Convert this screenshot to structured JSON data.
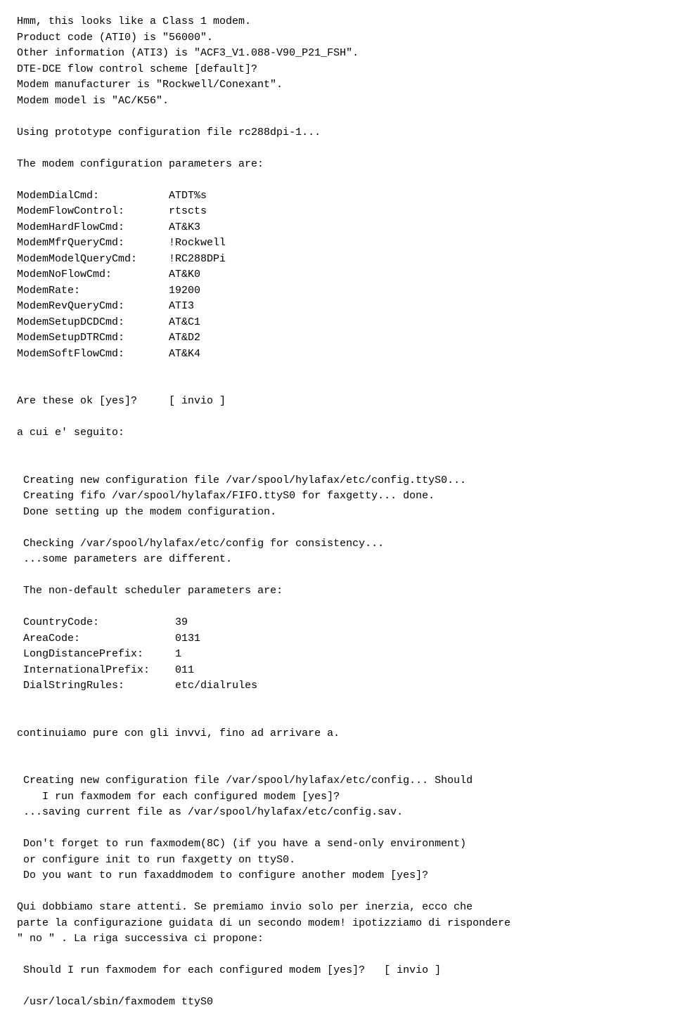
{
  "content": {
    "lines": [
      "Hmm, this looks like a Class 1 modem.",
      "Product code (ATI0) is \"56000\".",
      "Other information (ATI3) is \"ACF3_V1.088-V90_P21_FSH\".",
      "DTE-DCE flow control scheme [default]?",
      "Modem manufacturer is \"Rockwell/Conexant\".",
      "Modem model is \"AC/K56\".",
      "",
      "Using prototype configuration file rc288dpi-1...",
      "",
      "The modem configuration parameters are:",
      "",
      "ModemDialCmd:           ATDT%s",
      "ModemFlowControl:       rtscts",
      "ModemHardFlowCmd:       AT&K3",
      "ModemMfrQueryCmd:       !Rockwell",
      "ModemModelQueryCmd:     !RC288DPi",
      "ModemNoFlowCmd:         AT&K0",
      "ModemRate:              19200",
      "ModemRevQueryCmd:       ATI3",
      "ModemSetupDCDCmd:       AT&C1",
      "ModemSetupDTRCmd:       AT&D2",
      "ModemSoftFlowCmd:       AT&K4",
      "",
      "",
      "Are these ok [yes]?     [ invio ]",
      "",
      "a cui e' seguito:",
      "",
      "",
      " Creating new configuration file /var/spool/hylafax/etc/config.ttyS0...",
      " Creating fifo /var/spool/hylafax/FIFO.ttyS0 for faxgetty... done.",
      " Done setting up the modem configuration.",
      "",
      " Checking /var/spool/hylafax/etc/config for consistency...",
      " ...some parameters are different.",
      "",
      " The non-default scheduler parameters are:",
      "",
      " CountryCode:            39",
      " AreaCode:               0131",
      " LongDistancePrefix:     1",
      " InternationalPrefix:    011",
      " DialStringRules:        etc/dialrules",
      "",
      "",
      "continuiamo pure con gli invvi, fino ad arrivare a.",
      "",
      "",
      " Creating new configuration file /var/spool/hylafax/etc/config... Should",
      "    I run faxmodem for each configured modem [yes]?",
      " ...saving current file as /var/spool/hylafax/etc/config.sav.",
      "",
      " Don't forget to run faxmodem(8C) (if you have a send-only environment)",
      " or configure init to run faxgetty on ttyS0.",
      " Do you want to run faxaddmodem to configure another modem [yes]?",
      "",
      "Qui dobbiamo stare attenti. Se premiamo invio solo per inerzia, ecco che",
      "parte la configurazione guidata di un secondo modem! ipotizziamo di rispondere",
      "\" no \" . La riga successiva ci propone:",
      "",
      " Should I run faxmodem for each configured modem [yes]?   [ invio ]",
      "",
      " /usr/local/sbin/faxmodem ttyS0"
    ]
  }
}
